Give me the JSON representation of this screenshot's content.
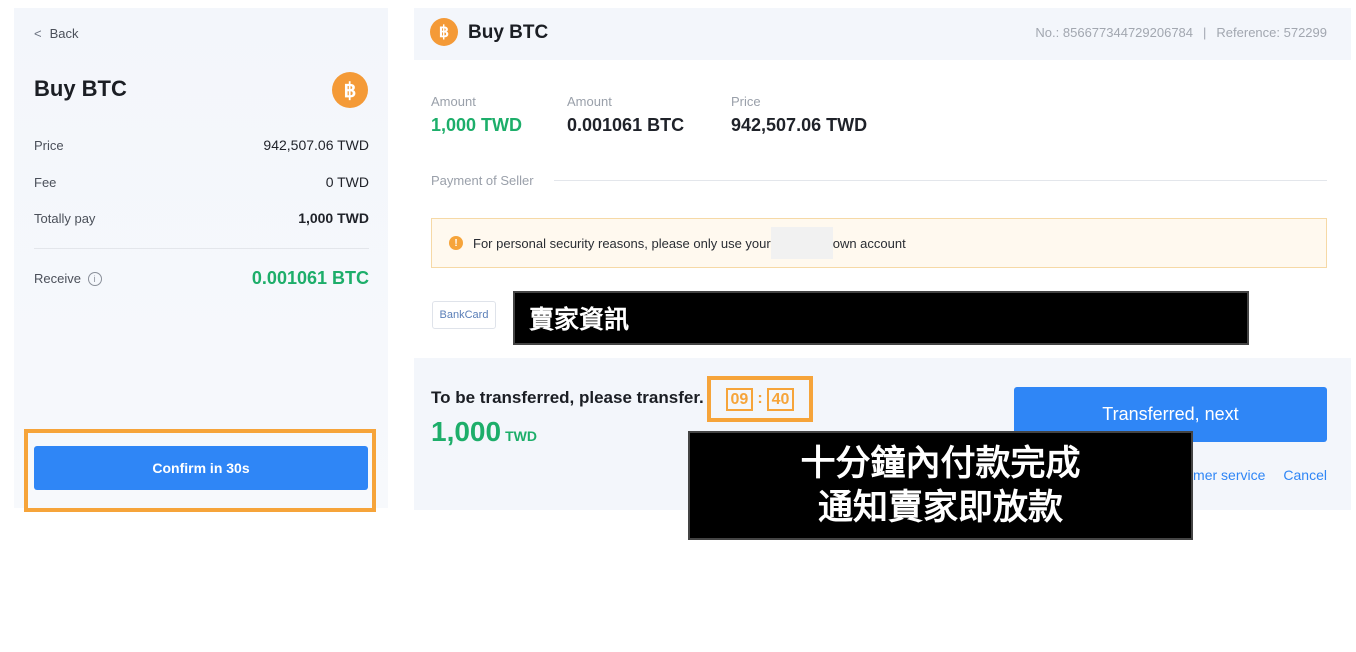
{
  "left": {
    "back_label": "Back",
    "back_icon": "chevron-left-icon",
    "title": "Buy BTC",
    "coin_symbol": "฿",
    "rows": [
      {
        "label": "Price",
        "value": "942,507.06 TWD"
      },
      {
        "label": "Fee",
        "value": "0 TWD"
      },
      {
        "label": "Totally pay",
        "value": "1,000 TWD"
      }
    ],
    "receive_label": "Receive",
    "receive_info_icon": "i",
    "receive_value": "0.001061 BTC",
    "confirm_label": "Confirm in 30s"
  },
  "right": {
    "title": "Buy BTC",
    "coin_symbol": "฿",
    "order_no": "No.:  856677344729206784",
    "separator": "|",
    "reference": "Reference:  572299",
    "amount1_label": "Amount",
    "amount1_value": "1,000 TWD",
    "amount2_label": "Amount",
    "amount2_value": "0.001061 BTC",
    "price_label": "Price",
    "price_value": "942,507.06 TWD",
    "payment_label": "Payment of Seller",
    "notice_icon": "!",
    "notice_before": "For personal security reasons, please only use your",
    "notice_after": "own account",
    "bankcard_label": "BankCard",
    "seller_info_overlay": "賣家資訊",
    "transfer_text": "To be transferred, please transfer.",
    "timer_minutes": "09",
    "timer_colon": ":",
    "timer_seconds": "40",
    "transfer_amount": "1,000",
    "transfer_unit": "TWD",
    "next_label": "Transferred, next",
    "customer_service_label": "mer service",
    "cancel_label": "Cancel"
  },
  "caption": {
    "line1": "十分鐘內付款完成",
    "line2": "通知賣家即放款"
  },
  "colors": {
    "accent_blue": "#2f86f6",
    "green": "#1dae6a",
    "orange_highlight": "#f6a43a",
    "btc_orange": "#f49a37"
  }
}
